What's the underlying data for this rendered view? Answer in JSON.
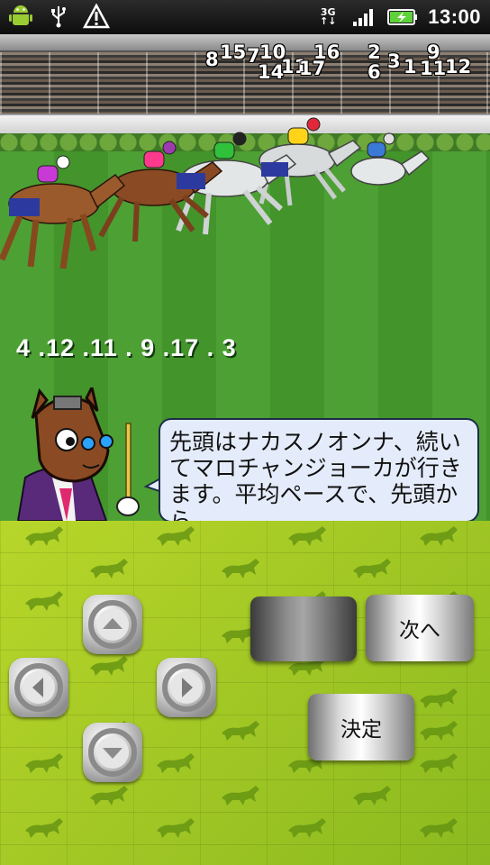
{
  "status_bar": {
    "time": "13:00",
    "network": "3G",
    "icons": [
      "android-icon",
      "usb-icon",
      "warning-icon",
      "network-3g-icon",
      "signal-icon",
      "battery-charging-icon"
    ]
  },
  "race": {
    "live_standings": [
      "8",
      "15",
      "7",
      "10",
      "14",
      "11",
      "17",
      "16",
      "2",
      "6",
      "3",
      "1",
      "9",
      "11",
      "12"
    ],
    "running_order": "4 .12 .11 . 9 .17 . 3",
    "commentary": "先頭はナカスノオンナ、続いてマロチャンジョーカが行きます。平均ペースで、先頭から"
  },
  "controls": {
    "dpad": {
      "up_icon": "arrow-up-icon",
      "left_icon": "arrow-left-icon",
      "right_icon": "arrow-right-icon",
      "down_icon": "arrow-down-icon"
    },
    "blank_label": "",
    "next_label": "次へ",
    "confirm_label": "決定"
  },
  "colors": {
    "bubble_bg": "#e4ecfb",
    "pad_green": "#a9cc24",
    "turf_green": "#4da033"
  }
}
